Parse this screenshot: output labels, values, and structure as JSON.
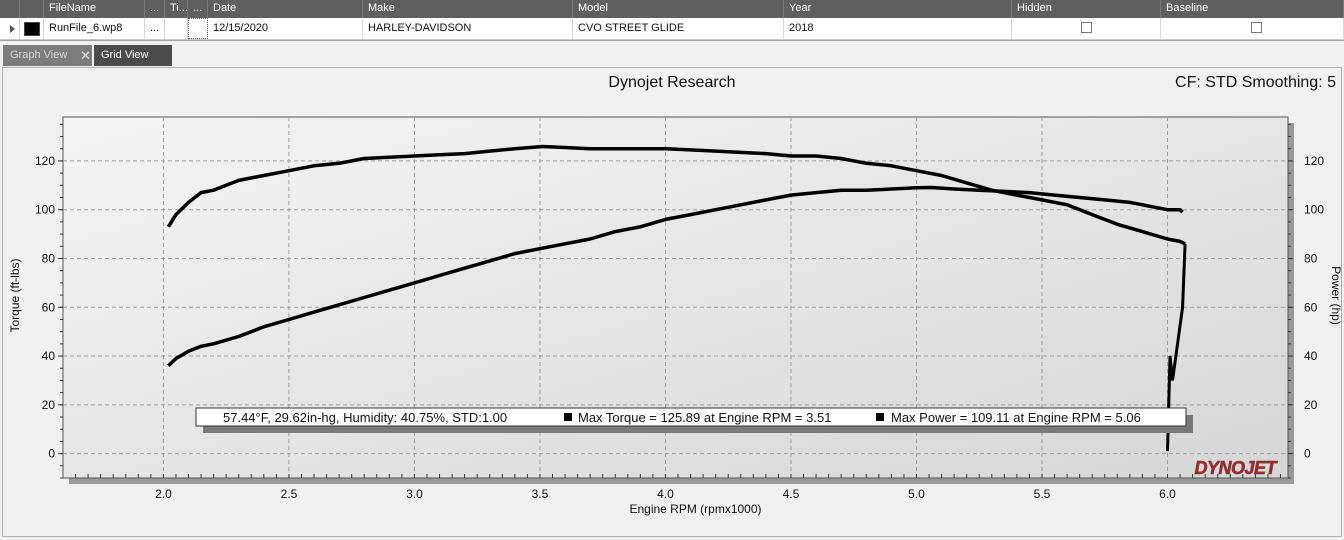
{
  "grid": {
    "columns": [
      {
        "label": "",
        "w": 20
      },
      {
        "label": "",
        "w": 24
      },
      {
        "label": "FileName",
        "w": 101
      },
      {
        "label": "...",
        "w": 20
      },
      {
        "label": "Ti...",
        "w": 23
      },
      {
        "label": "...",
        "w": 20
      },
      {
        "label": "Date",
        "w": 155
      },
      {
        "label": "Make",
        "w": 210
      },
      {
        "label": "Model",
        "w": 211
      },
      {
        "label": "Year",
        "w": 228
      },
      {
        "label": "Hidden",
        "w": 149
      },
      {
        "label": "Baseline",
        "w": 183
      }
    ],
    "row": {
      "filename": "RunFile_6.wp8",
      "c1": "...",
      "c2": "",
      "c3": "",
      "date": "12/15/2020",
      "make": "HARLEY-DAVIDSON",
      "model": "CVO STREET GLIDE",
      "year": "2018",
      "hidden": false,
      "baseline": false,
      "swatch_color": "#000000"
    }
  },
  "tabs": {
    "graph_view": "Graph View",
    "grid_view": "Grid View",
    "close": "✕"
  },
  "chart": {
    "title": "Dynojet Research",
    "cf_label": "CF: STD  Smoothing: 5",
    "logo": "DYNOJET",
    "info": {
      "conditions": "57.44°F, 29.62in-hg, Humidity: 40.75%, STD:1.00",
      "max_torque": "Max Torque = 125.89 at Engine RPM = 3.51",
      "max_power": "Max Power = 109.11 at Engine RPM = 5.06"
    }
  },
  "chart_data": {
    "type": "line",
    "title": "Dynojet Research",
    "xlabel": "Engine RPM (rpmx1000)",
    "ylabel": "Torque (ft-lbs)",
    "y2label": "Power (hp)",
    "xlim": [
      1.6,
      6.48
    ],
    "ylim": [
      -10,
      138
    ],
    "y2lim": [
      -10,
      138
    ],
    "x_ticks": [
      "2.0",
      "2.5",
      "3.0",
      "3.5",
      "4.0",
      "4.5",
      "5.0",
      "5.5",
      "6.0"
    ],
    "y_ticks": [
      "0",
      "20",
      "40",
      "60",
      "80",
      "100",
      "120"
    ],
    "y2_ticks": [
      "0",
      "20",
      "40",
      "60",
      "80",
      "100",
      "120"
    ],
    "grid": true,
    "series": [
      {
        "name": "Torque",
        "axis": "left",
        "color": "#000000",
        "x": [
          2.02,
          2.05,
          2.1,
          2.15,
          2.2,
          2.25,
          2.3,
          2.4,
          2.5,
          2.6,
          2.7,
          2.8,
          2.9,
          3.0,
          3.1,
          3.2,
          3.3,
          3.4,
          3.51,
          3.6,
          3.7,
          3.8,
          3.9,
          4.0,
          4.1,
          4.2,
          4.3,
          4.4,
          4.5,
          4.6,
          4.7,
          4.8,
          4.9,
          5.0,
          5.1,
          5.2,
          5.3,
          5.4,
          5.5,
          5.6,
          5.7,
          5.8,
          5.9,
          6.0,
          6.05,
          6.07
        ],
        "values": [
          93,
          98,
          103,
          107,
          108,
          110,
          112,
          114,
          116,
          118,
          119,
          121,
          121.5,
          122,
          122.5,
          123,
          124,
          125,
          125.89,
          125.5,
          125,
          125,
          125,
          125,
          124.5,
          124,
          123.5,
          123,
          122,
          122,
          121,
          119,
          118,
          116,
          114,
          111,
          108,
          106,
          104,
          102,
          98,
          94,
          91,
          88,
          87,
          86
        ]
      },
      {
        "name": "Power",
        "axis": "right",
        "color": "#000000",
        "x": [
          2.02,
          2.05,
          2.1,
          2.15,
          2.2,
          2.3,
          2.4,
          2.5,
          2.6,
          2.7,
          2.8,
          2.9,
          3.0,
          3.1,
          3.2,
          3.3,
          3.4,
          3.5,
          3.6,
          3.7,
          3.8,
          3.9,
          4.0,
          4.1,
          4.2,
          4.3,
          4.4,
          4.5,
          4.6,
          4.7,
          4.8,
          4.9,
          5.0,
          5.06,
          5.15,
          5.25,
          5.35,
          5.45,
          5.55,
          5.65,
          5.75,
          5.85,
          5.95,
          6.0,
          6.05,
          6.06
        ],
        "values": [
          36,
          39,
          42,
          44,
          45,
          48,
          52,
          55,
          58,
          61,
          64,
          67,
          70,
          73,
          76,
          79,
          82,
          84,
          86,
          88,
          91,
          93,
          96,
          98,
          100,
          102,
          104,
          106,
          107,
          108,
          108,
          108.5,
          109,
          109.11,
          108.5,
          108,
          107.5,
          107,
          106,
          105,
          104,
          103,
          101,
          100,
          100,
          99
        ]
      }
    ]
  }
}
